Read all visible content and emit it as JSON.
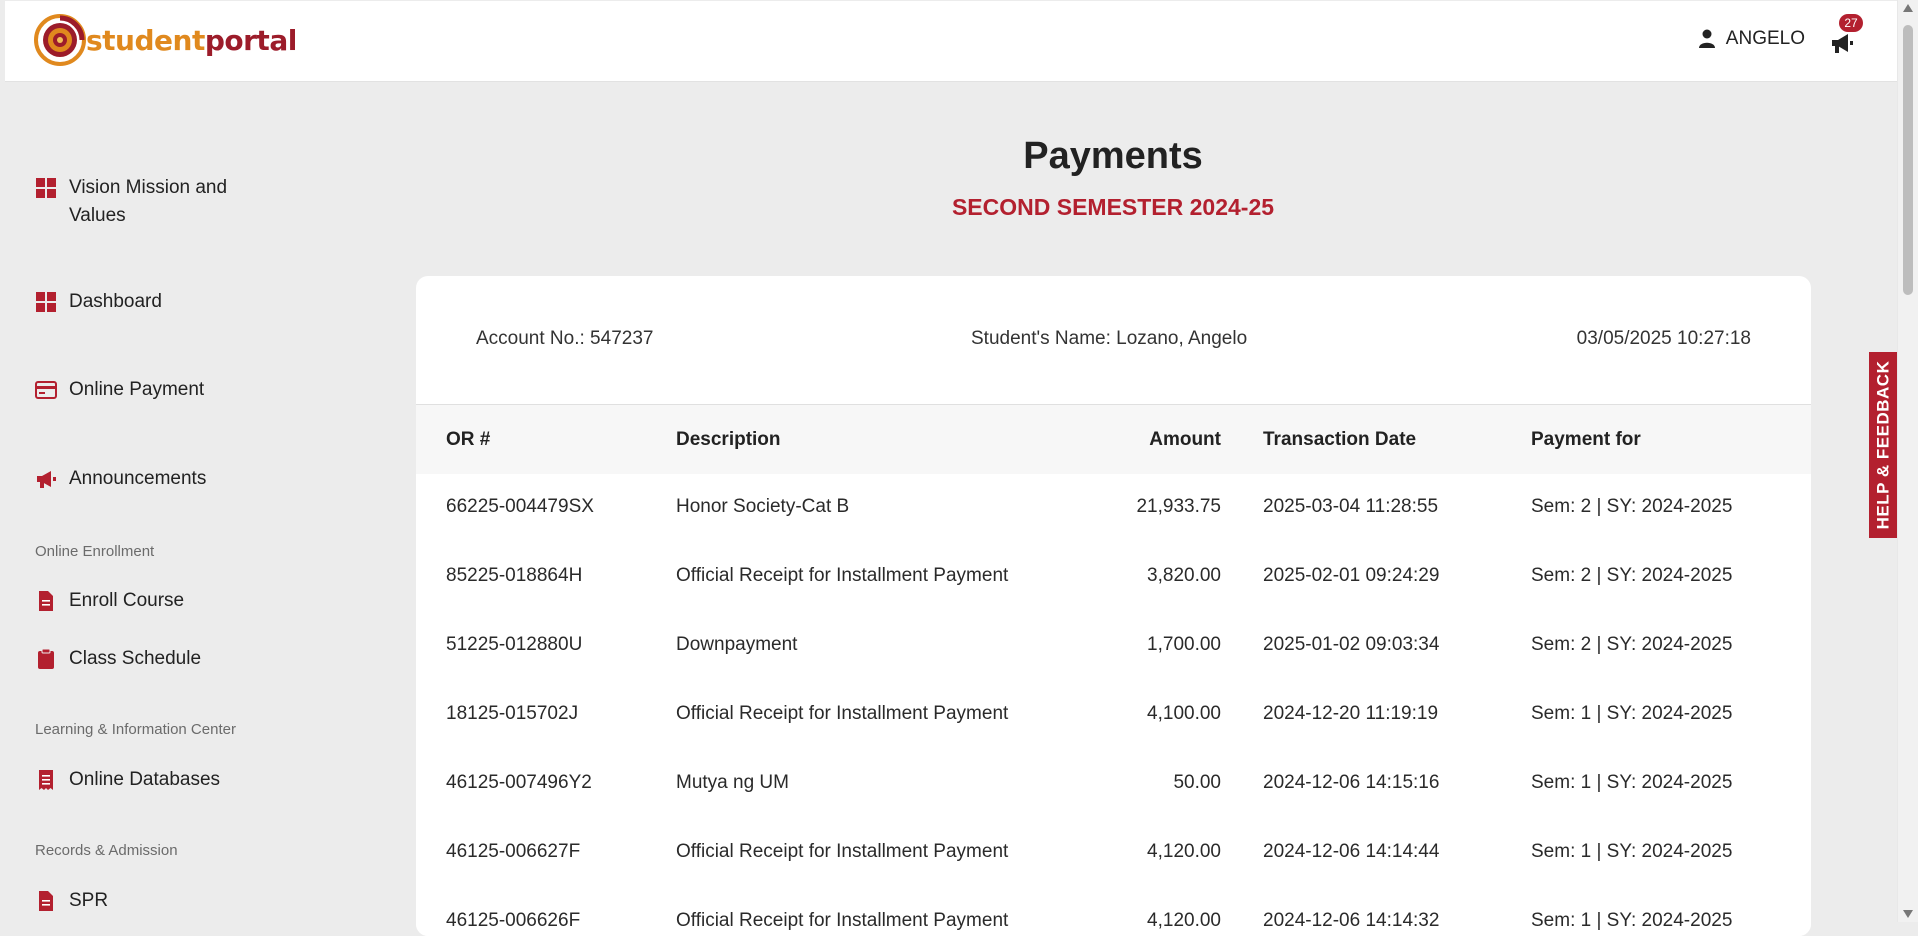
{
  "header": {
    "brand": {
      "part1": "student",
      "part2": "portal"
    },
    "user_name": "ANGELO",
    "notification_count": "27"
  },
  "sidebar": {
    "items": [
      {
        "label": "Vision Mission and Values",
        "icon": "grid-icon"
      },
      {
        "label": "Dashboard",
        "icon": "grid-icon"
      },
      {
        "label": "Online Payment",
        "icon": "credit-card-icon"
      },
      {
        "label": "Announcements",
        "icon": "megaphone-icon"
      }
    ],
    "sections": [
      {
        "title": "Online Enrollment",
        "items": [
          {
            "label": "Enroll Course",
            "icon": "file-icon"
          },
          {
            "label": "Class Schedule",
            "icon": "clipboard-icon"
          }
        ]
      },
      {
        "title": "Learning & Information Center",
        "items": [
          {
            "label": "Online Databases",
            "icon": "receipt-icon"
          }
        ]
      },
      {
        "title": "Records & Admission",
        "items": [
          {
            "label": "SPR",
            "icon": "file-icon"
          }
        ]
      }
    ]
  },
  "main": {
    "title": "Payments",
    "subtitle": "SECOND SEMESTER 2024-25",
    "account": "Account No.: 547237",
    "student": "Student's Name: Lozano, Angelo",
    "datetime": "03/05/2025 10:27:18",
    "table": {
      "headers": [
        "OR #",
        "Description",
        "Amount",
        "Transaction Date",
        "Payment for"
      ],
      "rows": [
        [
          "66225-004479SX",
          "Honor Society-Cat B",
          "21,933.75",
          "2025-03-04 11:28:55",
          "Sem: 2 | SY: 2024-2025"
        ],
        [
          "85225-018864H",
          "Official Receipt for Installment Payment",
          "3,820.00",
          "2025-02-01 09:24:29",
          "Sem: 2 | SY: 2024-2025"
        ],
        [
          "51225-012880U",
          "Downpayment",
          "1,700.00",
          "2025-01-02 09:03:34",
          "Sem: 2 | SY: 2024-2025"
        ],
        [
          "18125-015702J",
          "Official Receipt for Installment Payment",
          "4,100.00",
          "2024-12-20 11:19:19",
          "Sem: 1 | SY: 2024-2025"
        ],
        [
          "46125-007496Y2",
          "Mutya ng UM",
          "50.00",
          "2024-12-06 14:15:16",
          "Sem: 1 | SY: 2024-2025"
        ],
        [
          "46125-006627F",
          "Official Receipt for Installment Payment",
          "4,120.00",
          "2024-12-06 14:14:44",
          "Sem: 1 | SY: 2024-2025"
        ],
        [
          "46125-006626F",
          "Official Receipt for Installment Payment",
          "4,120.00",
          "2024-12-06 14:14:32",
          "Sem: 1 | SY: 2024-2025"
        ]
      ]
    }
  },
  "help_tab": "HELP & FEEDBACK",
  "colors": {
    "accent": "#b3202f",
    "brand_orange": "#e0891e",
    "brand_maroon": "#9c1c2a",
    "background": "#ececec"
  }
}
